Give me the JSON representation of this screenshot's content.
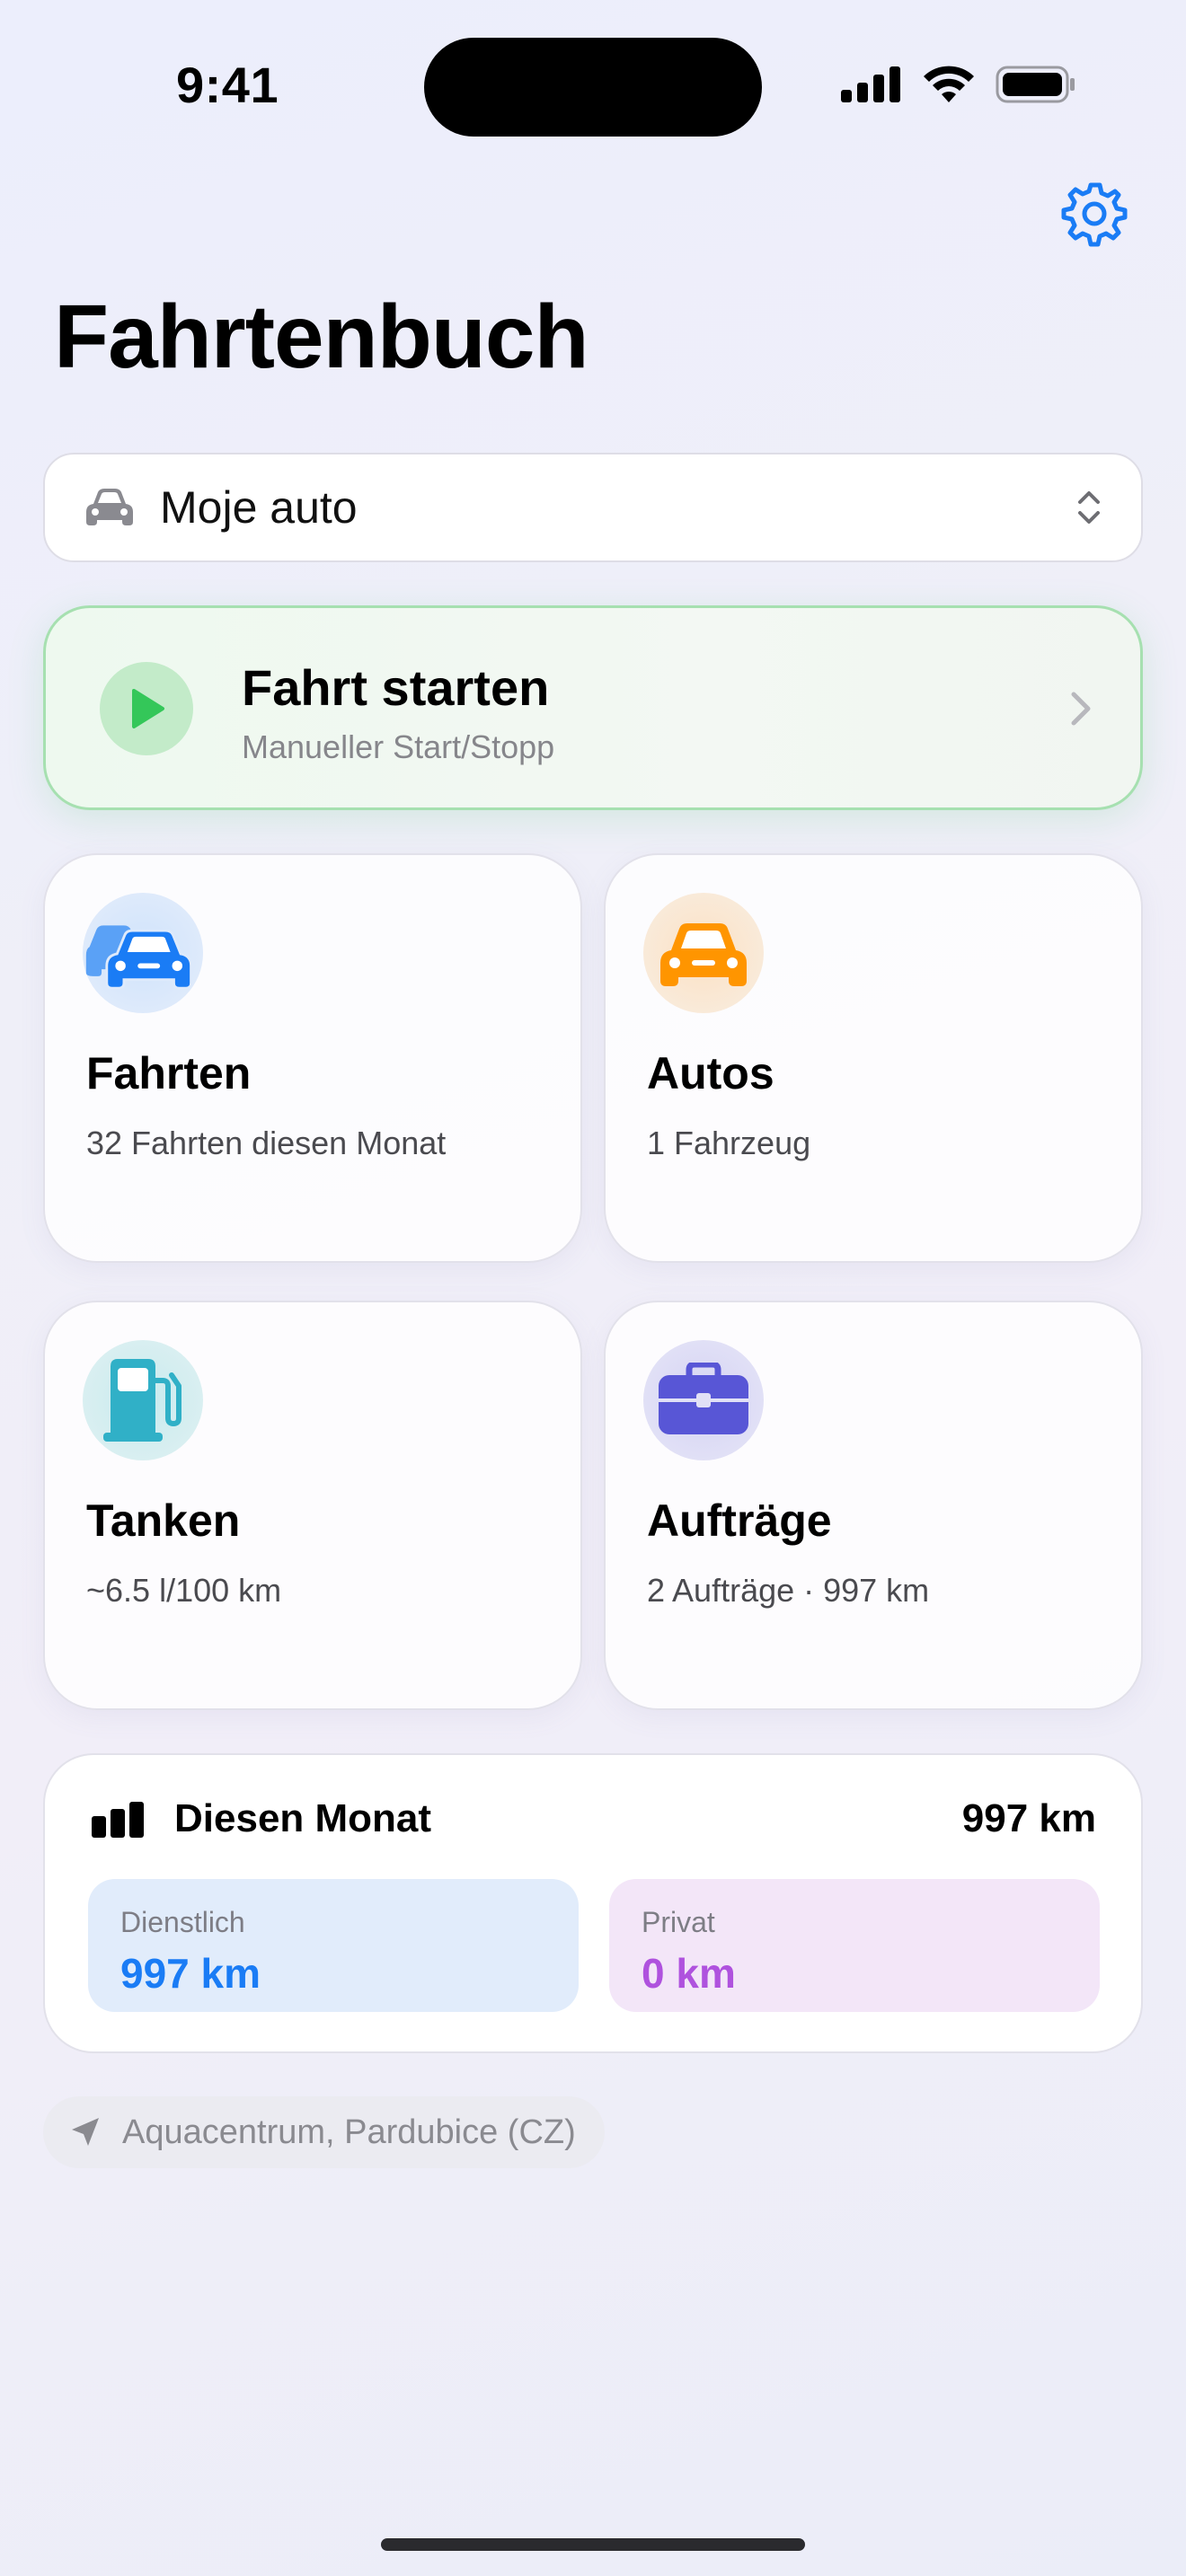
{
  "status_bar": {
    "time": "9:41"
  },
  "header": {
    "title": "Fahrtenbuch",
    "settings_icon": "gear-icon"
  },
  "car_picker": {
    "selected": "Moje auto"
  },
  "start_trip": {
    "title": "Fahrt starten",
    "subtitle": "Manueller Start/Stopp",
    "color": "#34c759"
  },
  "tiles": [
    {
      "title": "Fahrten",
      "subtitle": "32 Fahrten diesen Monat",
      "icon": "cars-icon",
      "color": "#1a7cf5"
    },
    {
      "title": "Autos",
      "subtitle": "1 Fahrzeug",
      "icon": "car-icon",
      "color": "#ff9500"
    },
    {
      "title": "Tanken",
      "subtitle": "~6.5 l/100 km",
      "icon": "fuel-pump-icon",
      "color": "#30b0c7"
    },
    {
      "title": "Aufträge",
      "subtitle": "2 Aufträge · 997 km",
      "icon": "briefcase-icon",
      "color": "#5856d6"
    }
  ],
  "month_summary": {
    "title": "Diesen Monat",
    "total": "997 km",
    "business": {
      "label": "Dienstlich",
      "value": "997 km",
      "color": "#1a7cf5"
    },
    "private": {
      "label": "Privat",
      "value": "0 km",
      "color": "#af52de"
    }
  },
  "location": {
    "text": "Aquacentrum, Pardubice (CZ)"
  }
}
